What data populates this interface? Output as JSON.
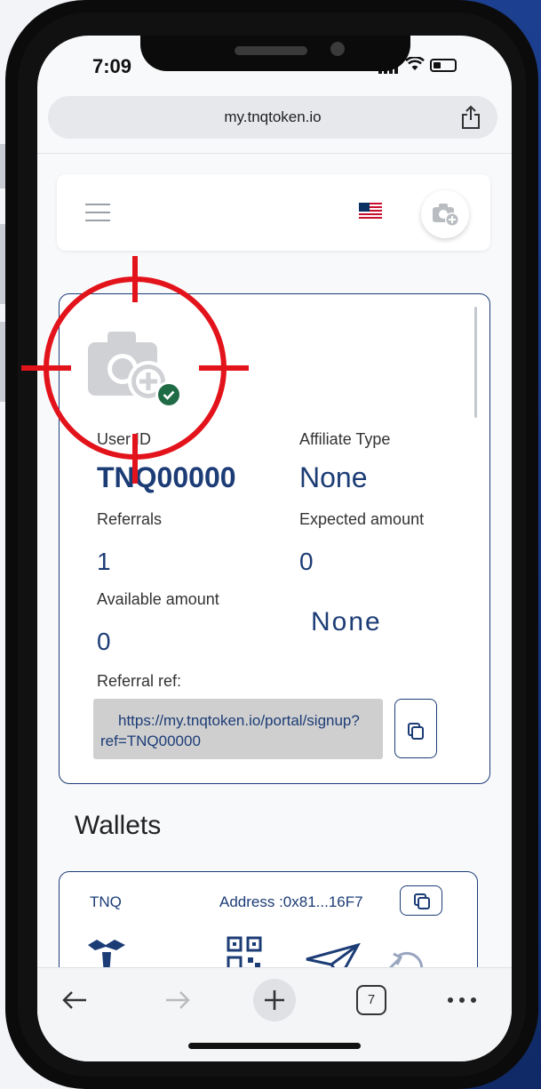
{
  "status_bar": {
    "time": "7:09"
  },
  "browser": {
    "url": "my.tnqtoken.io",
    "tab_count": "7"
  },
  "header": {
    "flag_icon": "us-flag-icon",
    "avatar_icon": "camera-plus-icon"
  },
  "profile": {
    "user_id_label": "User ID",
    "user_id_value": "TNQ00000",
    "affiliate_type_label": "Affiliate Type",
    "affiliate_type_value": "None",
    "referrals_label": "Referrals",
    "referrals_value": "1",
    "expected_amount_label": "Expected amount",
    "expected_amount_value": "0",
    "available_amount_label": "Available amount",
    "available_amount_value": "0",
    "status_value": "None",
    "referral_ref_label": "Referral ref:",
    "referral_ref_line1": "https://my.tnqtoken.io/portal/signup?",
    "referral_ref_line2": "ref=TNQ00000"
  },
  "wallets": {
    "title": "Wallets",
    "items": [
      {
        "name": "TNQ",
        "address": "Address :0x81...16F7"
      }
    ]
  },
  "colors": {
    "brand": "#1c3c76",
    "verified": "#1f6b45",
    "crosshair": "#e3131b"
  }
}
